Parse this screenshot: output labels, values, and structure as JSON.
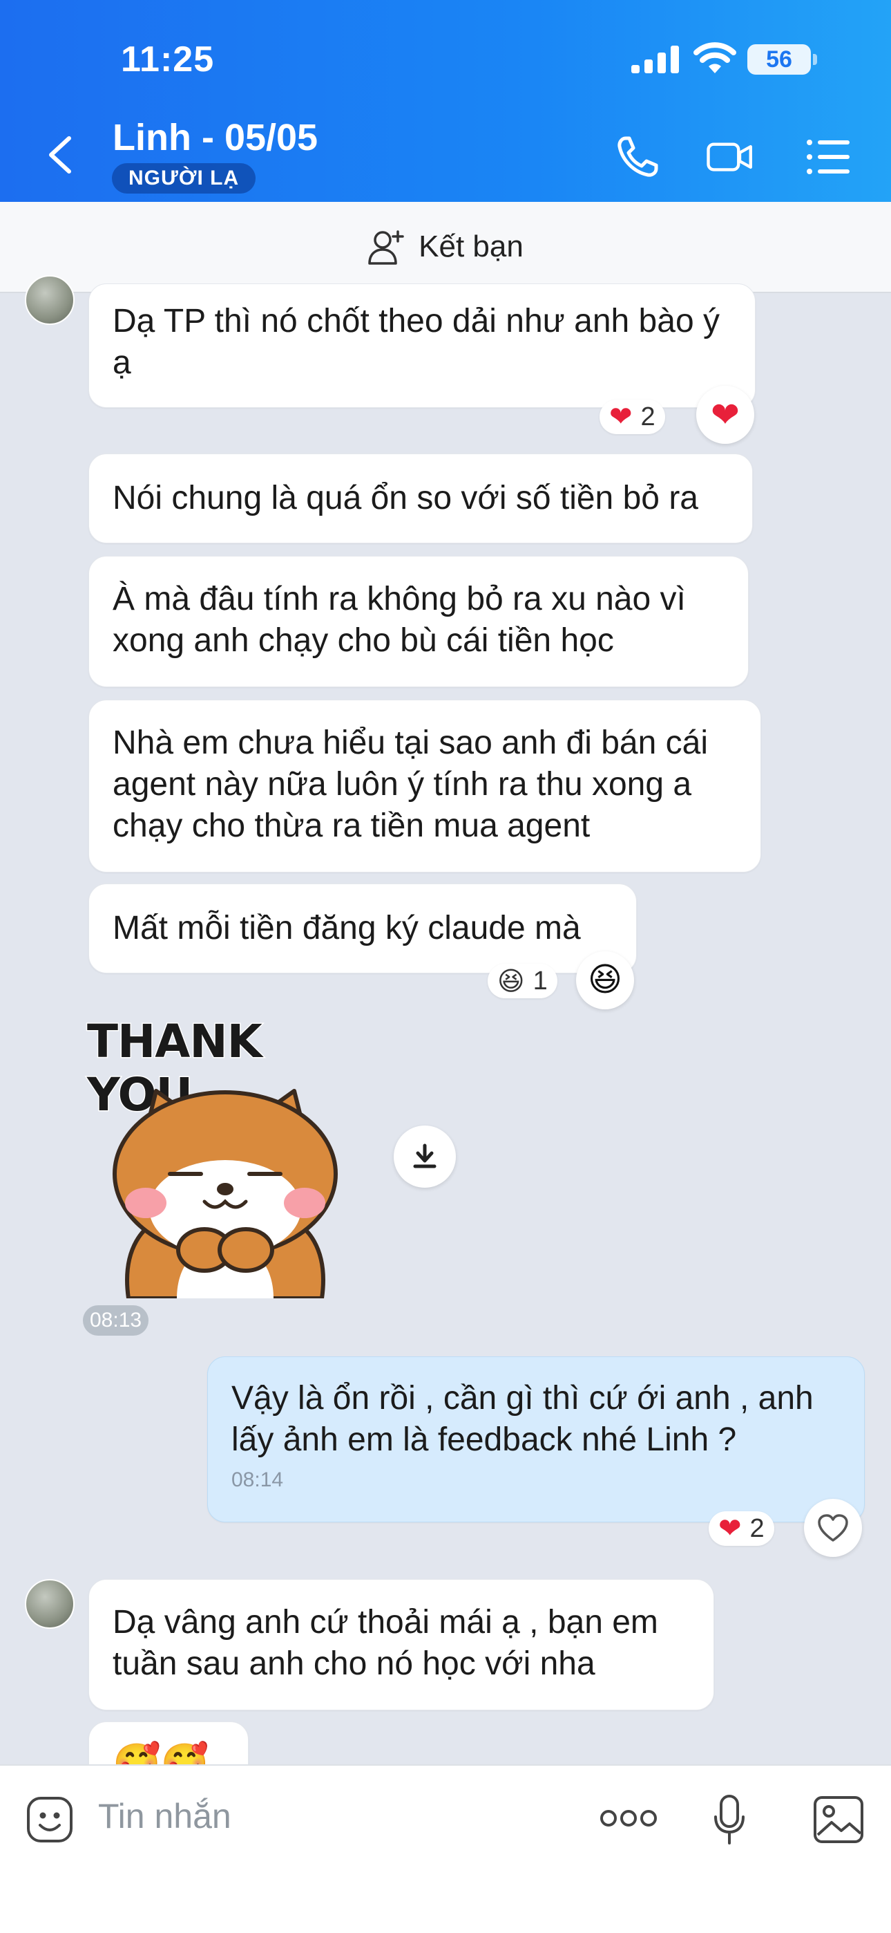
{
  "status_bar": {
    "time": "11:25",
    "battery": "56"
  },
  "header": {
    "title": "Linh - 05/05",
    "badge": "NGƯỜI LẠ"
  },
  "friend_bar": {
    "label": "Kết bạn"
  },
  "messages": [
    {
      "text": "Dạ TP thì nó chốt theo dải như anh bào ý ạ",
      "reaction_count": "2"
    },
    {
      "text": "Nói chung là quá ổn so với số tiền bỏ ra"
    },
    {
      "text": "À mà đâu tính ra không bỏ ra xu nào vì xong anh chạy cho bù cái tiền học"
    },
    {
      "text": "Nhà em chưa hiểu tại sao anh đi bán cái agent này nữa luôn ý tính ra thu xong a chạy cho thừa ra tiền mua agent"
    },
    {
      "text": "Mất mỗi tiền đăng ký claude mà",
      "reaction_count": "1"
    }
  ],
  "sticker": {
    "text": "THANK YOU",
    "time": "08:13"
  },
  "my_message": {
    "text": "Vậy là ổn rồi , cần gì thì cứ ới anh , anh lấy ảnh em là feedback nhé Linh ?",
    "time": "08:14",
    "reaction_count": "2"
  },
  "last_message": {
    "text": "Dạ vâng anh cứ thoải mái ạ , bạn em tuần sau anh cho nó học với nha"
  },
  "input": {
    "placeholder": "Tin nhắn"
  },
  "colors": {
    "header": "#1a86f5",
    "my_bubble": "#d6ebfd",
    "chat_bg": "#e2e6ee",
    "heart": "#e8203a"
  }
}
